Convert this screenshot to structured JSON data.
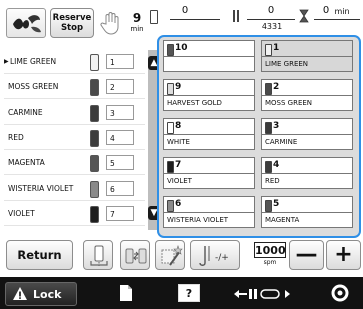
{
  "header": {
    "reserve_stop_line1": "Reserve",
    "reserve_stop_line2": "Stop",
    "min_value_1": "9",
    "min_unit_1": "min",
    "counter_a_value": "0",
    "counter_a_total": "",
    "counter_b_value": "0",
    "counter_b_total": "4331",
    "min_value_2": "0",
    "min_unit_2": "min"
  },
  "thread_list": [
    {
      "name": "LIME GREEN",
      "num": "1",
      "spool": "#f2f2f2",
      "marker": true
    },
    {
      "name": "MOSS GREEN",
      "num": "2",
      "spool": "#4a4a4a"
    },
    {
      "name": "CARMINE",
      "num": "3",
      "spool": "#3b3b3b"
    },
    {
      "name": "RED",
      "num": "4",
      "spool": "#3d3d3d"
    },
    {
      "name": "MAGENTA",
      "num": "5",
      "spool": "#555555"
    },
    {
      "name": "WISTERIA VIOLET",
      "num": "6",
      "spool": "#8a8a8a"
    },
    {
      "name": "VIOLET",
      "num": "7",
      "spool": "#1e1e1e"
    }
  ],
  "color_order": [
    {
      "num": "10",
      "name": "",
      "spool": "#555555"
    },
    {
      "num": "1",
      "name": "LIME GREEN",
      "spool": "#f2f2f2",
      "selected": true
    },
    {
      "num": "9",
      "name": "HARVEST GOLD",
      "spool": "#dddddd"
    },
    {
      "num": "2",
      "name": "MOSS GREEN",
      "spool": "#4a4a4a"
    },
    {
      "num": "8",
      "name": "WHITE",
      "spool": "#ffffff"
    },
    {
      "num": "3",
      "name": "CARMINE",
      "spool": "#3b3b3b"
    },
    {
      "num": "7",
      "name": "VIOLET",
      "spool": "#1e1e1e"
    },
    {
      "num": "4",
      "name": "RED",
      "spool": "#3d3d3d"
    },
    {
      "num": "6",
      "name": "WISTERIA VIOLET",
      "spool": "#8a8a8a"
    },
    {
      "num": "5",
      "name": "MAGENTA",
      "spool": "#555555"
    }
  ],
  "toolbar": {
    "return_label": "Return",
    "speed_value": "1000",
    "speed_unit": "spm",
    "minus_label": "—",
    "plus_label": "+"
  },
  "statusbar": {
    "lock_label": "Lock",
    "help_label": "?"
  },
  "colors": {
    "accent": "#2f8fe6",
    "statusbar": "#121212"
  }
}
